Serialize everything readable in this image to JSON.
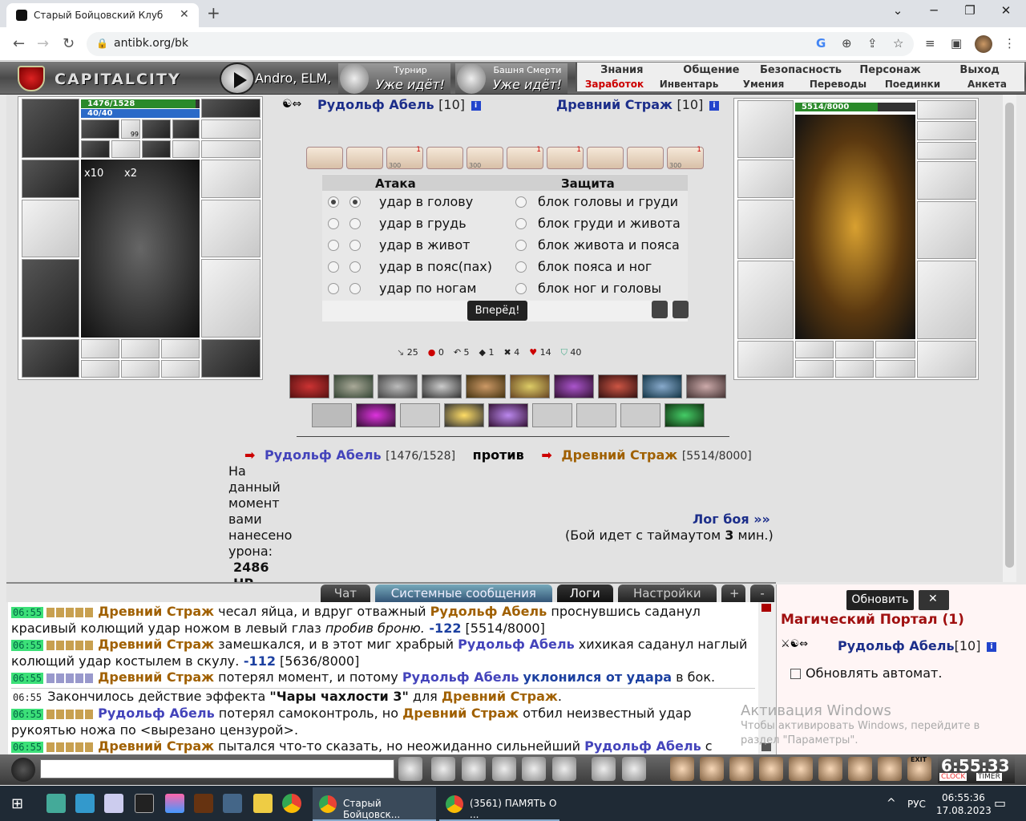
{
  "browser": {
    "tab_title": "Старый Бойцовский Клуб",
    "url": "antibk.org/bk",
    "close_tab": "✕",
    "new_tab": "+"
  },
  "game_menu": {
    "logo": "CAPITALCITY",
    "marquee": "Andro, ELM,",
    "event1": {
      "title": "Турнир",
      "status": "Уже идёт!"
    },
    "event2": {
      "title": "Башня Смерти",
      "status": "Уже идёт!"
    },
    "row1": [
      "Знания",
      "Общение",
      "Безопасность",
      "Персонаж",
      "Выход"
    ],
    "row2": [
      "Заработок",
      "Инвентарь",
      "Умения",
      "Переводы",
      "Поединки",
      "Анкета"
    ]
  },
  "player": {
    "name": "Рудольф Абель",
    "level": "[10]",
    "hp": "1476/1528",
    "hp_fraction": 0.966,
    "mana": "40/40",
    "mana_fraction": 1.0,
    "badge1": "x10",
    "badge2": "x2",
    "slot_count": "99"
  },
  "enemy": {
    "name": "Древний Страж",
    "level": "[10]",
    "hp": "5514/8000",
    "hp_fraction": 0.689
  },
  "fight": {
    "attack_header": "Атака",
    "defense_header": "Защита",
    "attacks": [
      "удар в голову",
      "удар в грудь",
      "удар в живот",
      "удар в пояс(пах)",
      "удар по ногам"
    ],
    "blocks": [
      "блок головы и груди",
      "блок груди и живота",
      "блок живота и пояса",
      "блок пояса и ног",
      "блок ног и головы"
    ],
    "go_button": "Вперёд!",
    "scroll_counts": [
      "1",
      "1",
      "1",
      "1"
    ],
    "scroll_sub": [
      "300",
      "300",
      "300"
    ]
  },
  "stats": [
    {
      "icon": "sword",
      "value": "25"
    },
    {
      "icon": "drop",
      "value": "0"
    },
    {
      "icon": "dodge",
      "value": "5"
    },
    {
      "icon": "shield",
      "value": "1"
    },
    {
      "icon": "cross",
      "value": "4"
    },
    {
      "icon": "heart",
      "value": "14"
    },
    {
      "icon": "armor",
      "value": "40"
    }
  ],
  "vs": {
    "p1": "Рудольф Абель",
    "p1_hp": "[1476/1528]",
    "word": "против",
    "p2": "Древний Страж",
    "p2_hp": "[5514/8000]"
  },
  "damage": {
    "text": "На данный момент вами нанесено урона:",
    "value": "2486",
    "unit": "HP"
  },
  "log_link": "Лог боя »»",
  "timeout": "(Бой идет с таймаутом",
  "timeout_value": "3",
  "timeout_unit": "мин.)",
  "chat_tabs": [
    "Чат",
    "Системные сообщения",
    "Логи",
    "Настройки",
    "+",
    "-"
  ],
  "chat": [
    {
      "time": "06:55",
      "a": "Древний Страж",
      "t1": " чесал яйца, и вдруг отважный ",
      "b": "Рудольф Абель",
      "t2": " проснувшись саданул красивый колющий удар ножом в левый глаз ",
      "em": "пробив броню.",
      "dmg": " -122",
      "hp": " [5514/8000]"
    },
    {
      "time": "06:55",
      "a": "Древний Страж",
      "t1": " замешкался, и в этот миг храбрый ",
      "b": "Рудольф Абель",
      "t2": " хихикая саданул наглый колющий удар костылем в скулу.",
      "em": "",
      "dmg": " -112",
      "hp": " [5636/8000]"
    },
    {
      "time": "06:55",
      "a": "Древний Страж",
      "t1": " потерял момент, и потому ",
      "b": "Рудольф Абель",
      "t2": " ",
      "em": "",
      "dmg": "уклонился от удара",
      "hp": " в бок."
    }
  ],
  "chat_effect": {
    "time": "06:55",
    "text": "Закончилось действие эффекта ",
    "effect": "\"Чары чахлости 3\"",
    "for": " для ",
    "name": "Древний Страж",
    "end": "."
  },
  "chat_line5": {
    "time": "06:55",
    "a": "Рудольф Абель",
    "t1": " потерял самоконтроль, но ",
    "b": "Древний Страж",
    "t2": " отбил неизвестный удар рукоятью ножа по <вырезано цензурой>."
  },
  "chat_line6": {
    "time": "06:55",
    "a": "Древний Страж",
    "t1": " пытался что-то сказать, но неожиданно сильнейший ",
    "b": "Рудольф Абель",
    "t2": " с"
  },
  "side": {
    "refresh": "Обновить",
    "location": "Магический Портал (1)",
    "user": "Рудольф Абель",
    "user_level": "[10]",
    "auto": "Обновлять автомат."
  },
  "watermark": {
    "title": "Активация Windows",
    "sub": "Чтобы активировать Windows, перейдите в раздел \"Параметры\"."
  },
  "clock": {
    "time": "6:55:33",
    "c1": "CLOCK",
    "c2": "TIMER",
    "exit": "EXIT"
  },
  "taskbar": {
    "app1": "Старый Бойцовск...",
    "app2": "(3561) ПАМЯТЬ О ...",
    "lang": "РУС",
    "time": "06:55:36",
    "date": "17.08.2023"
  },
  "colors": {
    "accent_blue": "#1c2e8a",
    "accent_orange": "#a06000",
    "accent_red": "#a01010",
    "hp_green": "#2a8a2a",
    "mana_blue": "#2a6ac8"
  }
}
